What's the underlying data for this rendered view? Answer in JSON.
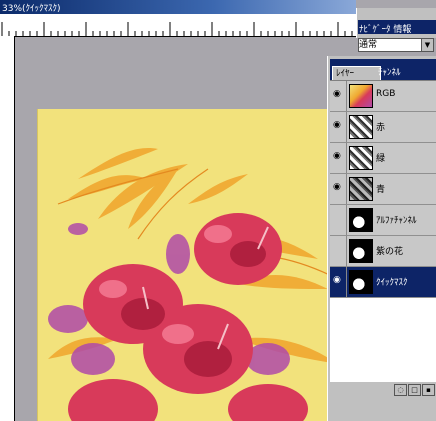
{
  "document": {
    "title": "33%(ｸｲｯｸﾏｽｸ)"
  },
  "palette_tabs": {
    "tab_navigator": "ﾅﾋﾞｹﾞｰﾀ",
    "tab_info": "情報",
    "blend_mode": "通常"
  },
  "layers_palette": {
    "tab_layers": "ﾚｲﾔｰ",
    "tab_channels": "ﾁｬﾝﾈﾙ",
    "channels": [
      {
        "name": "RGB",
        "visible": true,
        "thumb": "color"
      },
      {
        "name": "赤",
        "visible": true,
        "thumb": "gray"
      },
      {
        "name": "緑",
        "visible": true,
        "thumb": "gray"
      },
      {
        "name": "青",
        "visible": true,
        "thumb": "gray-dark"
      },
      {
        "name": "ｱﾙﾌｧﾁｬﾝﾈﾙ",
        "visible": false,
        "thumb": "mask"
      },
      {
        "name": "紫の花",
        "visible": false,
        "thumb": "mask"
      },
      {
        "name": "ｸｲｯｸﾏｽｸ",
        "visible": true,
        "thumb": "mask",
        "selected": true
      }
    ]
  },
  "colors": {
    "background": "#f2e27c",
    "hibiscus": "#d83a5a",
    "leaf": "#f0a830",
    "purple_flower": "#b04aa8",
    "title_blue": "#0d2467"
  }
}
